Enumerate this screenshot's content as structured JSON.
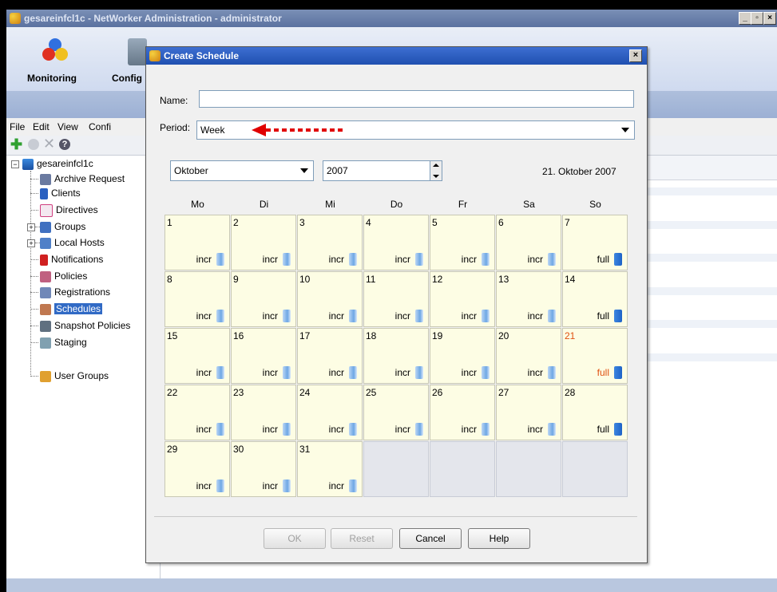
{
  "window": {
    "title": "gesareinfcl1c - NetWorker Administration - administrator",
    "controls": [
      "_",
      "▫",
      "×"
    ]
  },
  "toolbar": {
    "monitoring_label": "Monitoring",
    "config_label": "Config"
  },
  "menu": [
    "File",
    "Edit",
    "View",
    "Confi"
  ],
  "tree": {
    "root": "gesareinfcl1c",
    "items": [
      "Archive Request",
      "Clients",
      "Directives",
      "Groups",
      "Local Hosts",
      "Notifications",
      "Policies",
      "Registrations",
      "Schedules",
      "Snapshot Policies",
      "Staging",
      "User Groups"
    ],
    "selected": "Schedules"
  },
  "dialog": {
    "title": "Create Schedule",
    "close": "×",
    "name_label": "Name:",
    "name_value": "",
    "period_label": "Period:",
    "period_value": "Week",
    "month_value": "Oktober",
    "year_value": "2007",
    "date_display": "21. Oktober 2007",
    "weekdays": [
      "Mo",
      "Di",
      "Mi",
      "Do",
      "Fr",
      "Sa",
      "So"
    ],
    "days": [
      {
        "d": "1",
        "l": "incr"
      },
      {
        "d": "2",
        "l": "incr"
      },
      {
        "d": "3",
        "l": "incr"
      },
      {
        "d": "4",
        "l": "incr"
      },
      {
        "d": "5",
        "l": "incr"
      },
      {
        "d": "6",
        "l": "incr"
      },
      {
        "d": "7",
        "l": "full"
      },
      {
        "d": "8",
        "l": "incr"
      },
      {
        "d": "9",
        "l": "incr"
      },
      {
        "d": "10",
        "l": "incr"
      },
      {
        "d": "11",
        "l": "incr"
      },
      {
        "d": "12",
        "l": "incr"
      },
      {
        "d": "13",
        "l": "incr"
      },
      {
        "d": "14",
        "l": "full"
      },
      {
        "d": "15",
        "l": "incr"
      },
      {
        "d": "16",
        "l": "incr"
      },
      {
        "d": "17",
        "l": "incr"
      },
      {
        "d": "18",
        "l": "incr"
      },
      {
        "d": "19",
        "l": "incr"
      },
      {
        "d": "20",
        "l": "incr"
      },
      {
        "d": "21",
        "l": "full"
      },
      {
        "d": "22",
        "l": "incr"
      },
      {
        "d": "23",
        "l": "incr"
      },
      {
        "d": "24",
        "l": "incr"
      },
      {
        "d": "25",
        "l": "incr"
      },
      {
        "d": "26",
        "l": "incr"
      },
      {
        "d": "27",
        "l": "incr"
      },
      {
        "d": "28",
        "l": "full"
      },
      {
        "d": "29",
        "l": "incr"
      },
      {
        "d": "30",
        "l": "incr"
      },
      {
        "d": "31",
        "l": "incr"
      },
      {
        "d": "",
        "l": ""
      },
      {
        "d": "",
        "l": ""
      },
      {
        "d": "",
        "l": ""
      },
      {
        "d": "",
        "l": ""
      }
    ],
    "highlighted_day": "21",
    "buttons": {
      "ok": "OK",
      "reset": "Reset",
      "cancel": "Cancel",
      "help": "Help"
    }
  },
  "colors": {
    "title_bar": "#2050b0",
    "cell_bg": "#fdfde4",
    "highlight": "#e05010",
    "arrow": "#e00000"
  }
}
